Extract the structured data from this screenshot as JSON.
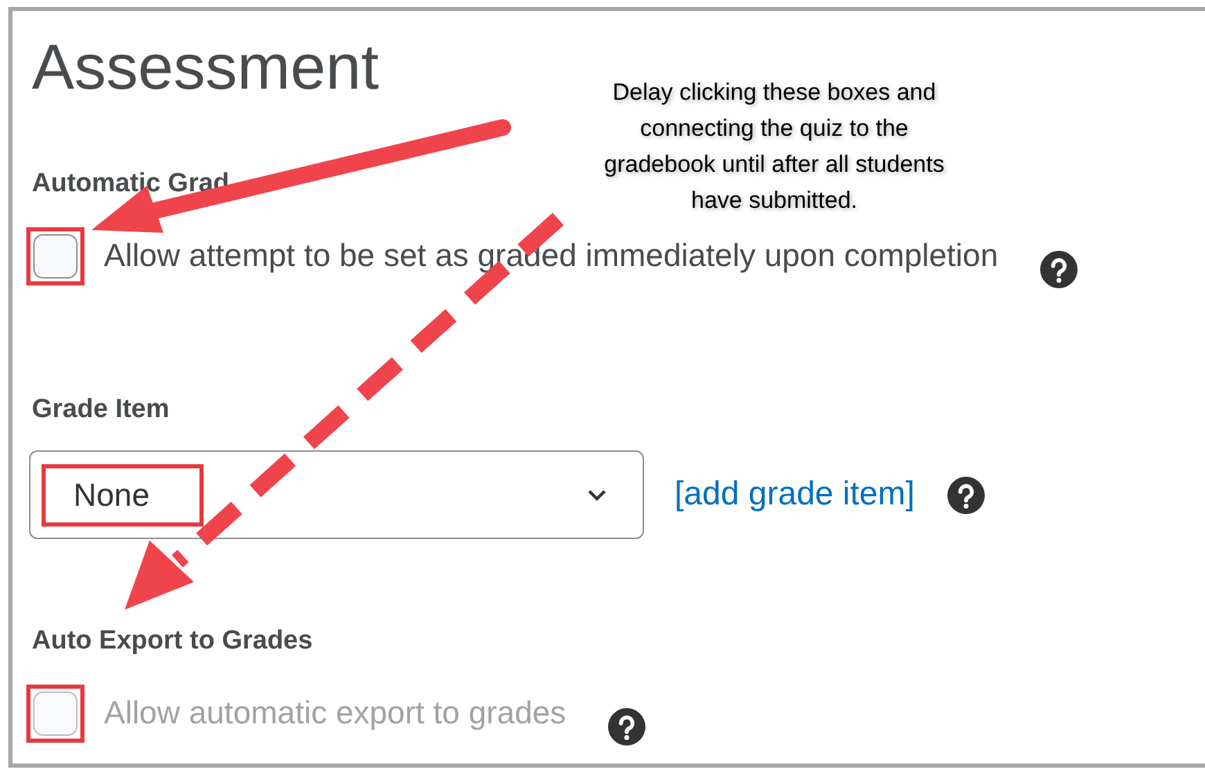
{
  "title": "Assessment",
  "callout": {
    "lines": [
      "Delay clicking these boxes and",
      "connecting the quiz to the",
      "gradebook until after all students",
      "have submitted."
    ]
  },
  "sections": [
    {
      "kind": "checkbox",
      "heading": "Automatic Grad",
      "label": "Allow attempt to be set as graded immediately upon completion",
      "checked": false,
      "disabled": false,
      "highlighted": true
    },
    {
      "kind": "select",
      "heading": "Grade Item",
      "value": "None",
      "highlighted": true,
      "link": "[add grade item]"
    },
    {
      "kind": "checkbox",
      "heading": "Auto Export to Grades",
      "label": "Allow automatic export to grades",
      "checked": false,
      "disabled": true,
      "highlighted": true
    }
  ]
}
